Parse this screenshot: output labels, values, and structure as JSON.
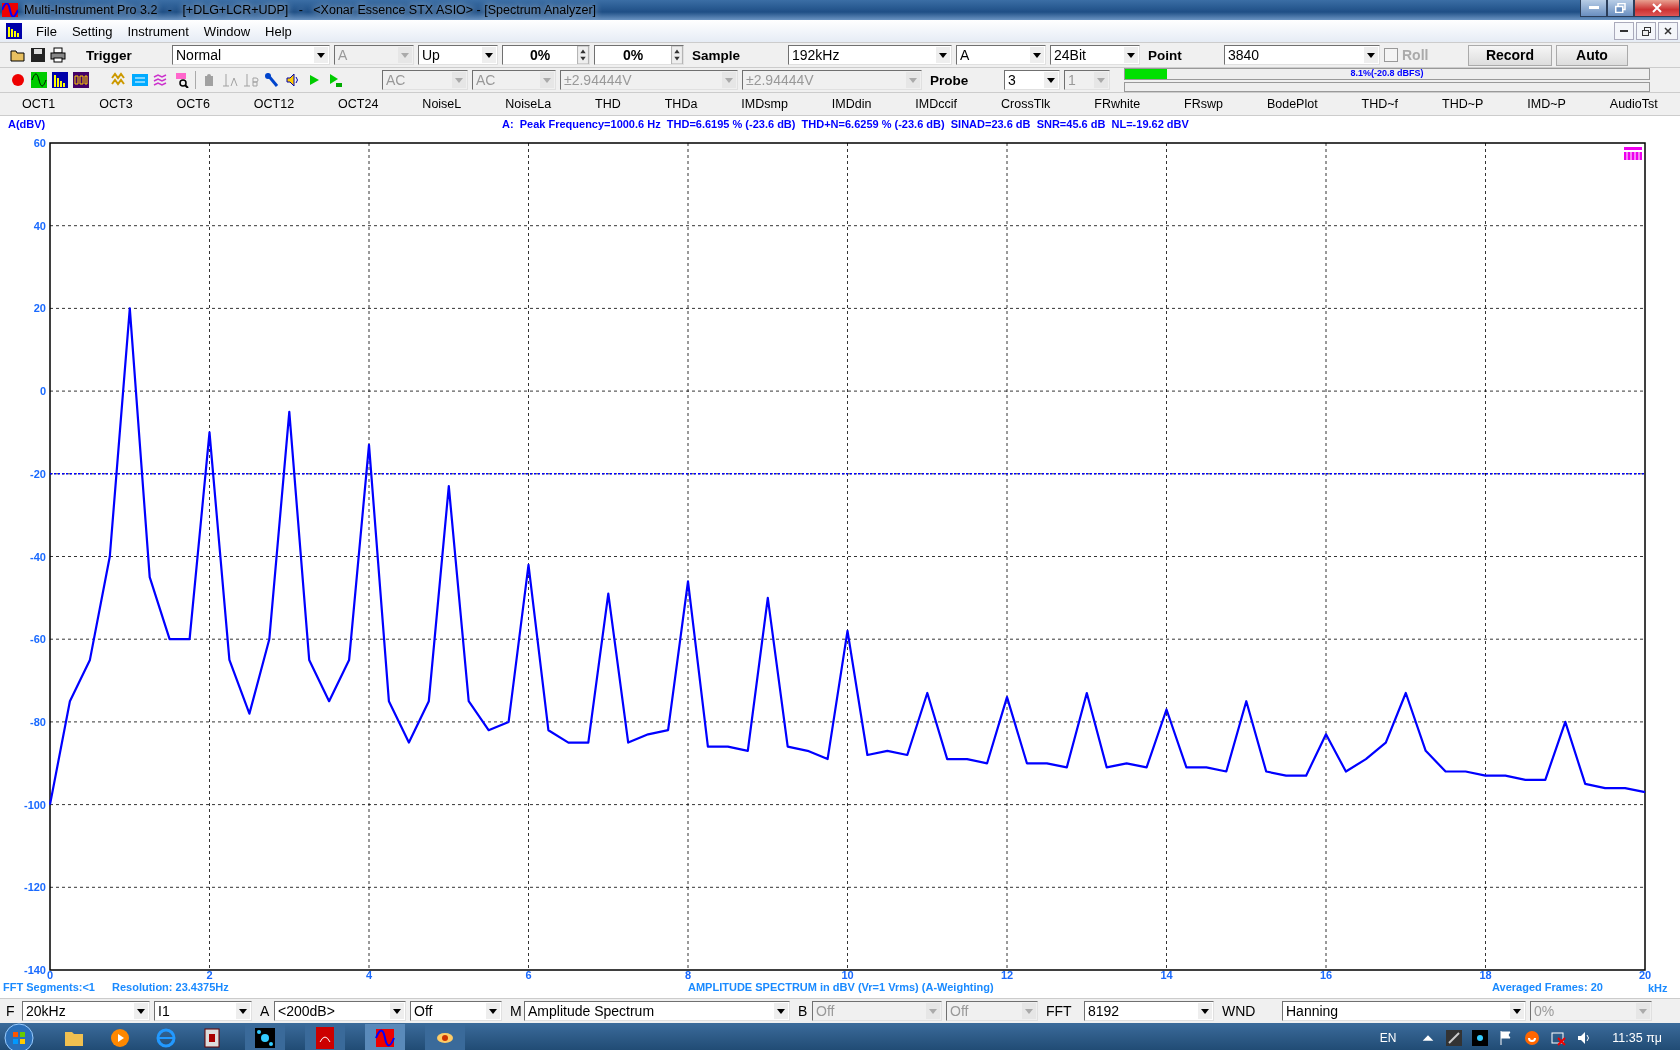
{
  "window": {
    "title": "Multi-Instrument Pro 3.2   -   [+DLG+LCR+UDP]   -   <Xonar Essence STX ASIO> - [Spectrum Analyzer]"
  },
  "menu": [
    "File",
    "Setting",
    "Instrument",
    "Window",
    "Help"
  ],
  "toolbar_1": [
    {
      "kind": "label",
      "text": "Trigger"
    },
    {
      "kind": "combo",
      "value": "Normal",
      "disabled": false
    },
    {
      "kind": "combo",
      "value": "A",
      "disabled": true
    },
    {
      "kind": "combo",
      "value": "Up",
      "disabled": false
    },
    {
      "kind": "spin",
      "value": "0%"
    },
    {
      "kind": "spin",
      "value": "0%"
    },
    {
      "kind": "label",
      "text": "Sample"
    },
    {
      "kind": "combo",
      "value": "192kHz",
      "disabled": false
    },
    {
      "kind": "combo",
      "value": "A",
      "disabled": false
    },
    {
      "kind": "combo",
      "value": "24Bit",
      "disabled": false
    },
    {
      "kind": "label",
      "text": "Point"
    },
    {
      "kind": "combo",
      "value": "3840",
      "disabled": false
    },
    {
      "kind": "check",
      "text": "Roll",
      "checked": false,
      "disabled": true
    },
    {
      "kind": "button",
      "text": "Record"
    },
    {
      "kind": "button",
      "text": "Auto"
    }
  ],
  "toolbar_2": [
    {
      "kind": "combo",
      "value": "AC",
      "disabled": true
    },
    {
      "kind": "combo",
      "value": "AC",
      "disabled": true
    },
    {
      "kind": "combo",
      "value": "±2.94444V",
      "disabled": true
    },
    {
      "kind": "combo",
      "value": "±2.94444V",
      "disabled": true
    },
    {
      "kind": "label",
      "text": "Probe"
    },
    {
      "kind": "combo",
      "value": "3",
      "disabled": false
    },
    {
      "kind": "combo",
      "value": "1",
      "disabled": true
    },
    {
      "kind": "meter",
      "level": 0.081,
      "reading": "8.1%(-20.8 dBFS)"
    }
  ],
  "functions": [
    "OCT1",
    "OCT3",
    "OCT6",
    "OCT12",
    "OCT24",
    "NoiseL",
    "NoiseLa",
    "THD",
    "THDa",
    "IMDsmp",
    "IMDdin",
    "IMDccif",
    "CrossTlk",
    "FRwhite",
    "FRswp",
    "BodePlot",
    "THD~f",
    "THD~P",
    "IMD~P",
    "AudioTst"
  ],
  "info": {
    "axis_unit": "A(dBV)",
    "measurements": "A:  Peak Frequency=1000.6 Hz  THD=6.6195 % (-23.6 dB)  THD+N=6.6259 % (-23.6 dB)  SINAD=23.6 dB  SNR=45.6 dB  NL=-19.62 dBV"
  },
  "chart": {
    "chart_data": {
      "type": "line",
      "title": "AMPLITUDE SPECTRUM in dBV (Vr=1 Vrms) (A-Weighting)",
      "xlabel": "kHz",
      "x": [
        0,
        0.25,
        0.5,
        0.75,
        1,
        1.25,
        1.5,
        1.75,
        2,
        2.25,
        2.5,
        2.75,
        3,
        3.25,
        3.5,
        3.75,
        4,
        4.25,
        4.5,
        4.75,
        5,
        5.25,
        5.5,
        5.75,
        6,
        6.25,
        6.5,
        6.75,
        7,
        7.25,
        7.5,
        7.75,
        8,
        8.25,
        8.5,
        8.75,
        9,
        9.25,
        9.5,
        9.75,
        10,
        10.25,
        10.5,
        10.75,
        11,
        11.25,
        11.5,
        11.75,
        12,
        12.25,
        12.5,
        12.75,
        13,
        13.25,
        13.5,
        13.75,
        14,
        14.25,
        14.5,
        14.75,
        15,
        15.25,
        15.5,
        15.75,
        16,
        16.25,
        16.5,
        16.75,
        17,
        17.25,
        17.5,
        17.75,
        18,
        18.25,
        18.5,
        18.75,
        19,
        19.25,
        19.5,
        19.75,
        20
      ],
      "series": [
        {
          "color": "#0000ff",
          "values": [
            -100,
            -75,
            -65,
            -40,
            20,
            -45,
            -60,
            -60,
            -10,
            -65,
            -78,
            -60,
            -5,
            -65,
            -75,
            -65,
            -13,
            -75,
            -85,
            -75,
            -23,
            -75,
            -82,
            -80,
            -42,
            -82,
            -85,
            -85,
            -49,
            -85,
            -83,
            -82,
            -46,
            -86,
            -86,
            -87,
            -50,
            -86,
            -87,
            -89,
            -58,
            -88,
            -87,
            -88,
            -73,
            -89,
            -89,
            -90,
            -74,
            -90,
            -90,
            -91,
            -73,
            -91,
            -90,
            -91,
            -77,
            -91,
            -91,
            -92,
            -75,
            -92,
            -93,
            -93,
            -83,
            -92,
            -89,
            -85,
            -73,
            -87,
            -92,
            -92,
            -93,
            -93,
            -94,
            -94,
            -80,
            -95,
            -96,
            -96,
            -97
          ]
        }
      ],
      "xlim": [
        0,
        20
      ],
      "ylim": [
        -140,
        60
      ],
      "xticks": [
        0,
        2,
        4,
        6,
        8,
        10,
        12,
        14,
        16,
        18,
        20
      ],
      "yticks": [
        -140,
        -120,
        -100,
        -80,
        -60,
        -40,
        -20,
        0,
        20,
        40,
        60
      ],
      "grid": true,
      "ref_lines": [
        {
          "axis": "y",
          "value": -20
        }
      ]
    },
    "segments": "FFT Segments:<1",
    "resolution": "Resolution: 23.4375Hz",
    "averaged": "Averaged Frames: 20"
  },
  "bottom_bar": [
    {
      "kind": "label",
      "text": "F"
    },
    {
      "kind": "combo",
      "value": "20kHz",
      "disabled": false
    },
    {
      "kind": "combo",
      "value": "I1",
      "disabled": false
    },
    {
      "kind": "label",
      "text": "A"
    },
    {
      "kind": "combo",
      "value": "<200dB>",
      "disabled": false
    },
    {
      "kind": "combo",
      "value": "Off",
      "disabled": false
    },
    {
      "kind": "label",
      "text": "M"
    },
    {
      "kind": "combo",
      "value": "Amplitude Spectrum",
      "disabled": false
    },
    {
      "kind": "label",
      "text": "B"
    },
    {
      "kind": "combo",
      "value": "Off",
      "disabled": true
    },
    {
      "kind": "combo",
      "value": "Off",
      "disabled": true
    },
    {
      "kind": "label",
      "text": "FFT"
    },
    {
      "kind": "combo",
      "value": "8192",
      "disabled": false
    },
    {
      "kind": "label",
      "text": "WND"
    },
    {
      "kind": "combo",
      "value": "Hanning",
      "disabled": false
    },
    {
      "kind": "combo",
      "value": "0%",
      "disabled": true
    }
  ],
  "taskbar": {
    "language": "EN",
    "clock": "11:35 πμ"
  }
}
